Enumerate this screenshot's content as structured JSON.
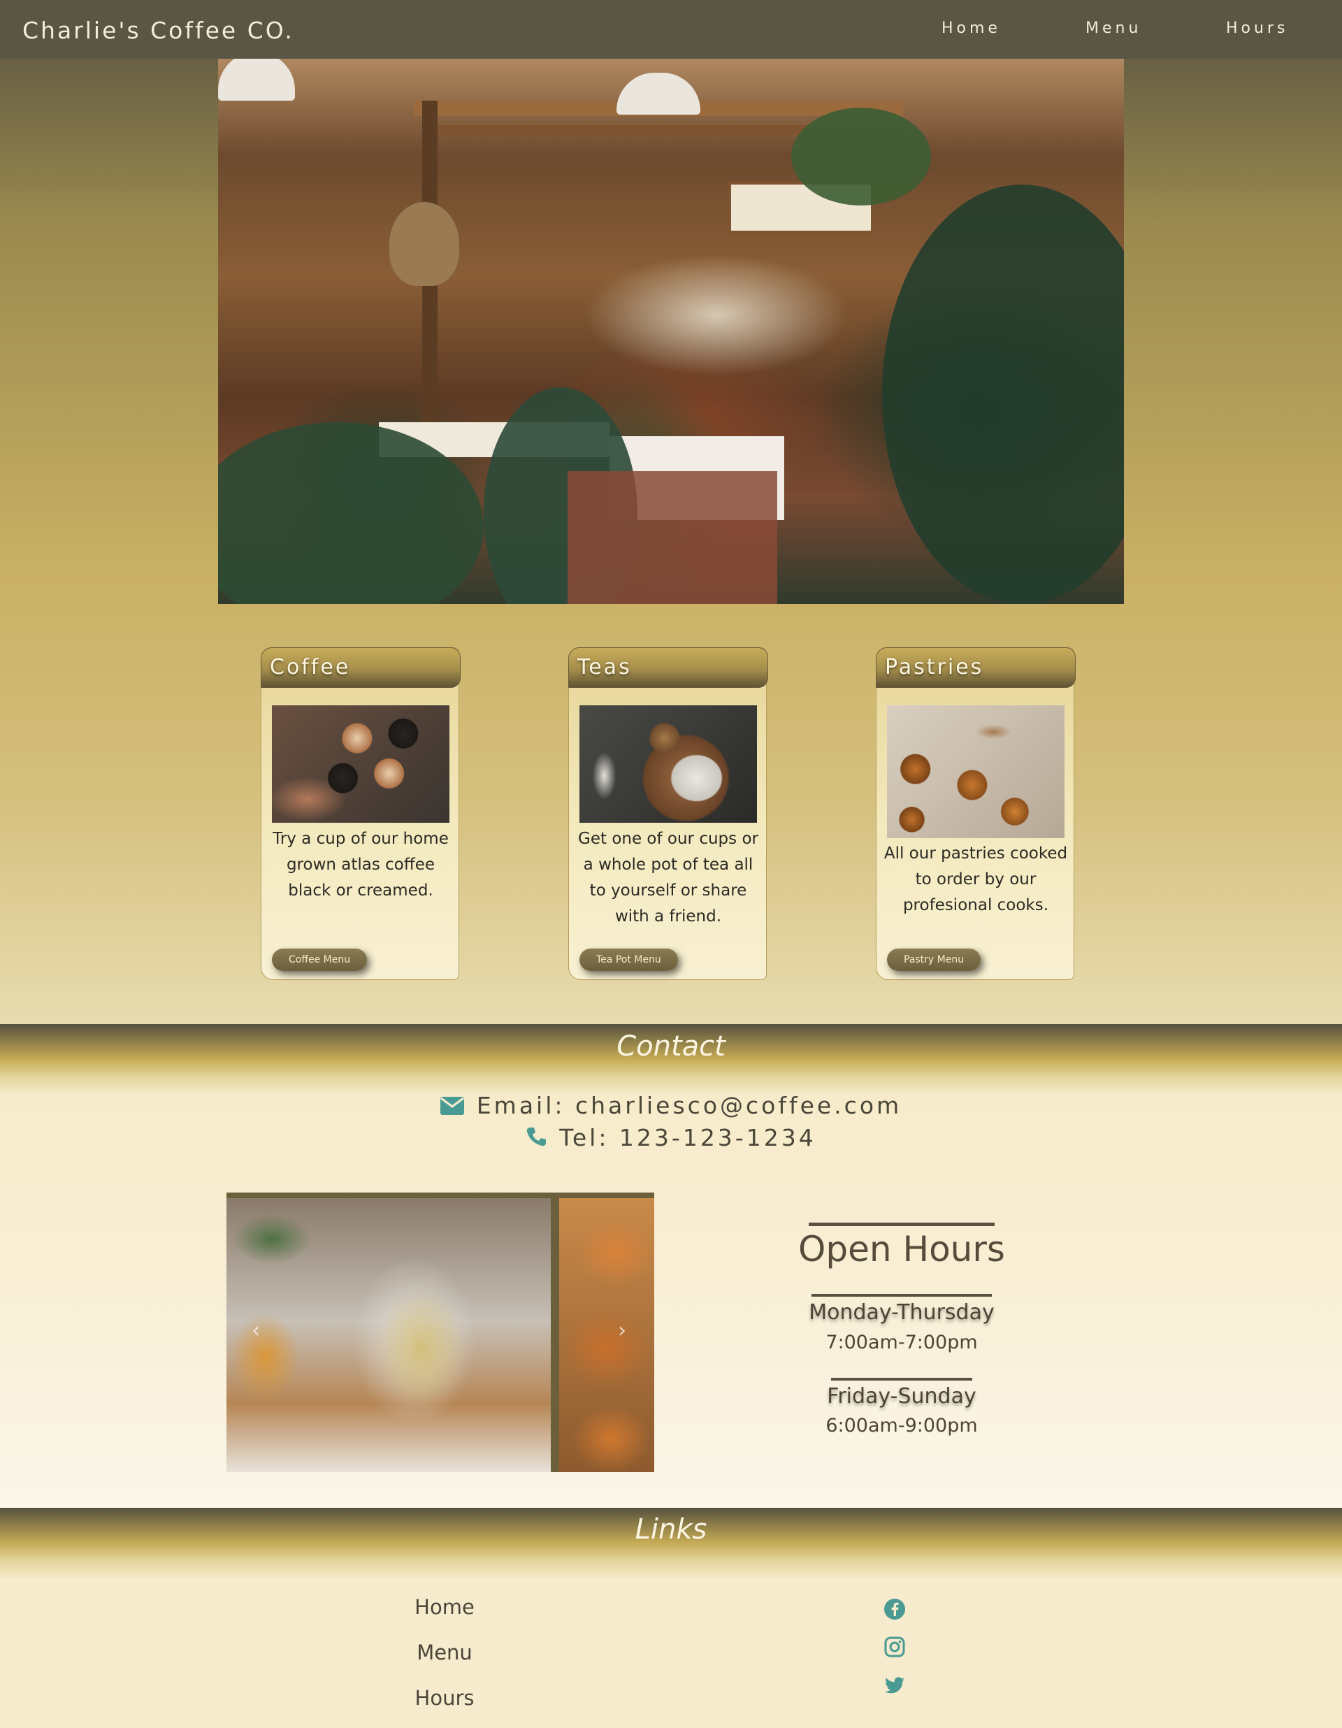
{
  "brand": "Charlie's Coffee CO.",
  "nav": {
    "home": "Home",
    "menu": "Menu",
    "hours": "Hours"
  },
  "cards": [
    {
      "title": "Coffee",
      "text": "Try a cup of our home grown atlas coffee black or creamed.",
      "button": "Coffee Menu"
    },
    {
      "title": "Teas",
      "text": "Get one of our cups or a whole pot of tea all to yourself or share with a friend.",
      "button": "Tea Pot Menu"
    },
    {
      "title": "Pastries",
      "text": "All our pastries cooked to order by our profesional cooks.",
      "button": "Pastry Menu"
    }
  ],
  "contact": {
    "title": "Contact",
    "email": "Email: charliesco@coffee.com",
    "tel": "Tel: 123-123-1234",
    "email_icon": "envelope-icon",
    "phone_icon": "phone-icon"
  },
  "carousel": {
    "prev": "‹",
    "next": "›"
  },
  "hours": {
    "title": "Open Hours",
    "weekday": "Monday-Thursday",
    "weekday_time": "7:00am-7:00pm",
    "weekend": "Friday-Sunday",
    "weekend_time": "6:00am-9:00pm"
  },
  "links": {
    "title": "Links",
    "items": [
      "Home",
      "Menu",
      "Hours"
    ],
    "social": [
      "facebook-icon",
      "instagram-icon",
      "twitter-icon"
    ]
  },
  "colors": {
    "nav_bg": "#5a5645",
    "accent": "#4a9a94",
    "gold": "#c9b064"
  }
}
